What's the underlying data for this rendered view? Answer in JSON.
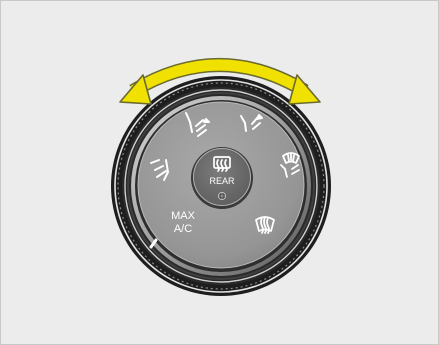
{
  "knob": {
    "label_max": "MAX",
    "label_ac": "A/C",
    "label_rear": "REAR"
  },
  "icons": {
    "rotation_arrow": "double-headed-rotation-arrow-icon",
    "face": "face-vent-icon",
    "bi_level": "bi-level-vent-icon",
    "floor": "floor-vent-icon",
    "floor_defrost": "floor-defrost-vent-icon",
    "defrost": "windshield-defrost-icon",
    "rear_defrost": "rear-window-defrost-icon"
  },
  "colors": {
    "background": "#ececec",
    "arrow": "#f1e100",
    "arrow_outline": "#6b6b30",
    "knob_face": "#949494",
    "bezel_dark": "#2b2b2b",
    "symbol": "#ffffff"
  }
}
